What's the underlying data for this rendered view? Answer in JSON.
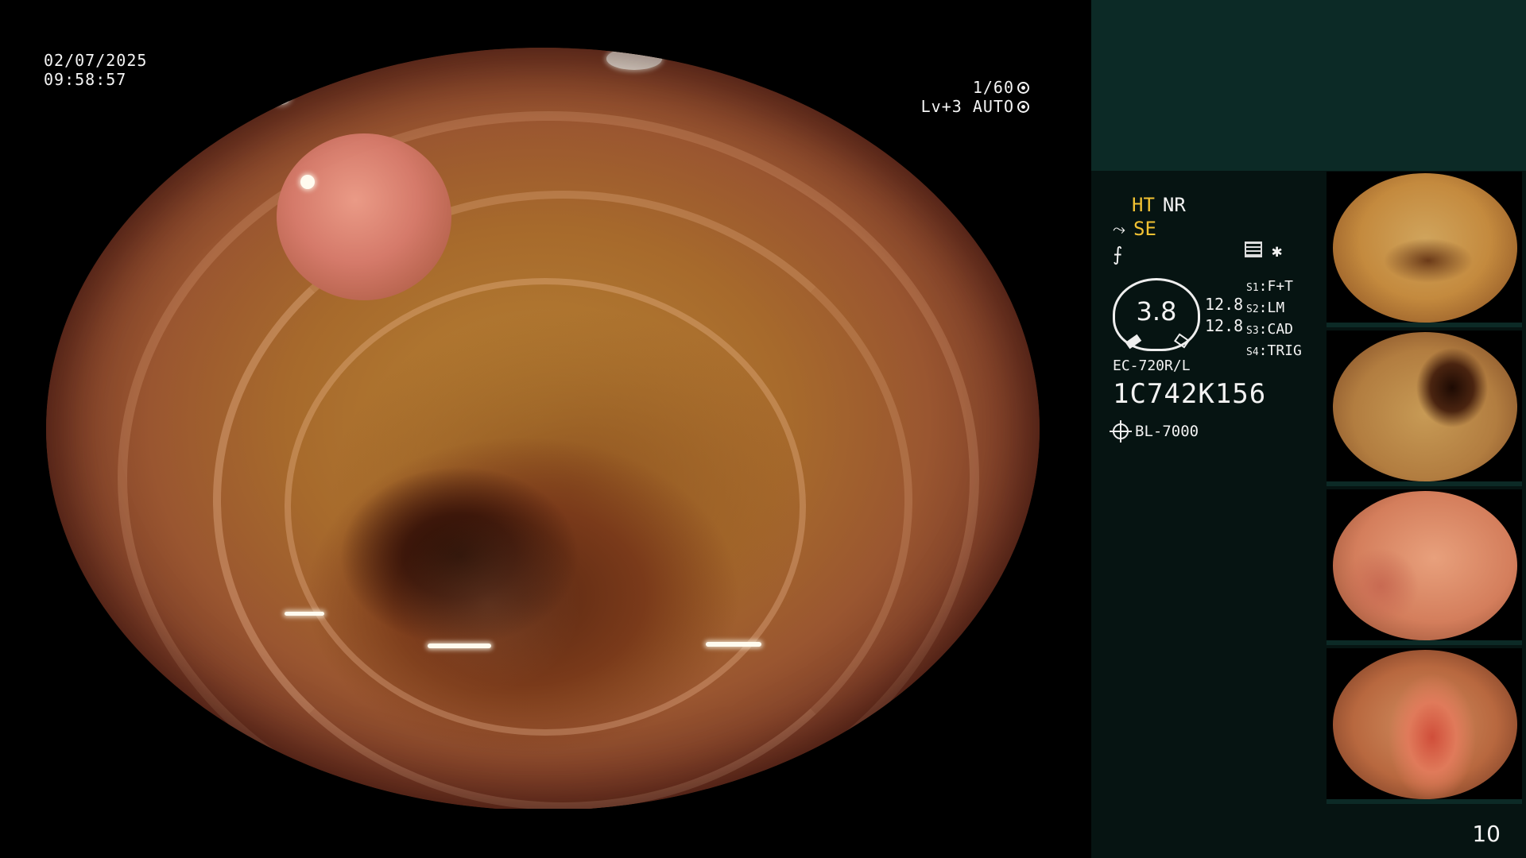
{
  "overlay": {
    "date": "02/07/2025",
    "time": "09:58:57",
    "shutter": "1/60",
    "exposure_mode": "Lv+3 AUTO"
  },
  "panel": {
    "mode_ht": "HT",
    "mode_nr": "NR",
    "mode_se": "SE",
    "mode_f_icon": "enhancement-icon",
    "mode_star": "✱",
    "gauge_value": "3.8",
    "gauge_side_1": "12.8",
    "gauge_side_2": "12.8",
    "settings": [
      {
        "key": "S1",
        "value": "F+T"
      },
      {
        "key": "S2",
        "value": "LM"
      },
      {
        "key": "S3",
        "value": "CAD"
      },
      {
        "key": "S4",
        "value": "TRIG"
      }
    ],
    "scope_model": "EC-720R/L",
    "serial": "1C742K156",
    "light_source": "BL-7000"
  },
  "page_number": "10",
  "colors": {
    "panel_top": "#0c2a26",
    "panel_main": "#061412",
    "accent_yellow": "#f2c233"
  }
}
